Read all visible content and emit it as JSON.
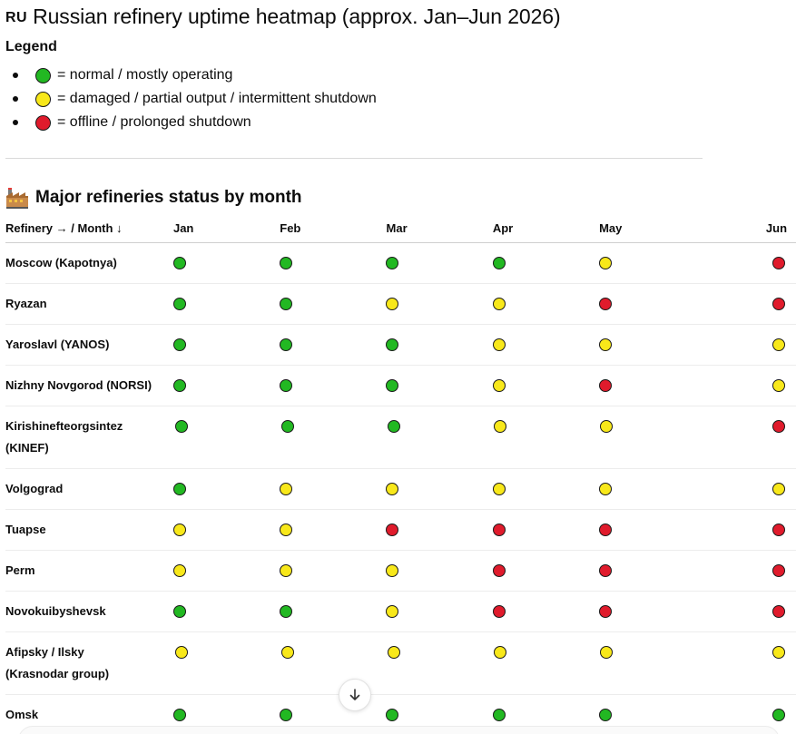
{
  "header": {
    "flag": "RU",
    "title": "Russian refinery uptime heatmap (approx. Jan–Jun 2026)"
  },
  "legend": {
    "heading": "Legend",
    "items": [
      {
        "status": "green",
        "label": "= normal / mostly operating"
      },
      {
        "status": "yellow",
        "label": "= damaged / partial output / intermittent shutdown"
      },
      {
        "status": "red",
        "label": "= offline / prolonged shutdown"
      }
    ]
  },
  "colors": {
    "green": "#22b822",
    "yellow": "#f8e81a",
    "red": "#e01b2c"
  },
  "section": {
    "icon": "factory-icon",
    "heading": "Major refineries status by month"
  },
  "table": {
    "corner_label": "Refinery → / Month ↓",
    "months": [
      "Jan",
      "Feb",
      "Mar",
      "Apr",
      "May",
      "Jun"
    ],
    "rows": [
      {
        "name": "Moscow (Kapotnya)",
        "statuses": [
          "green",
          "green",
          "green",
          "green",
          "yellow",
          "red"
        ]
      },
      {
        "name": "Ryazan",
        "statuses": [
          "green",
          "green",
          "yellow",
          "yellow",
          "red",
          "red"
        ]
      },
      {
        "name": "Yaroslavl (YANOS)",
        "statuses": [
          "green",
          "green",
          "green",
          "yellow",
          "yellow",
          "yellow"
        ]
      },
      {
        "name": "Nizhny Novgorod (NORSI)",
        "statuses": [
          "green",
          "green",
          "green",
          "yellow",
          "red",
          "yellow"
        ]
      },
      {
        "name": "Kirishinefteorgsintez (KINEF)",
        "statuses": [
          "green",
          "green",
          "green",
          "yellow",
          "yellow",
          "red"
        ]
      },
      {
        "name": "Volgograd",
        "statuses": [
          "green",
          "yellow",
          "yellow",
          "yellow",
          "yellow",
          "yellow"
        ]
      },
      {
        "name": "Tuapse",
        "statuses": [
          "yellow",
          "yellow",
          "red",
          "red",
          "red",
          "red"
        ]
      },
      {
        "name": "Perm",
        "statuses": [
          "yellow",
          "yellow",
          "yellow",
          "red",
          "red",
          "red"
        ]
      },
      {
        "name": "Novokuibyshevsk",
        "statuses": [
          "green",
          "green",
          "yellow",
          "red",
          "red",
          "red"
        ]
      },
      {
        "name": "Afipsky / Ilsky (Krasnodar group)",
        "statuses": [
          "yellow",
          "yellow",
          "yellow",
          "yellow",
          "yellow",
          "yellow"
        ]
      },
      {
        "name": "Omsk",
        "statuses": [
          "green",
          "green",
          "green",
          "green",
          "green",
          "green"
        ]
      }
    ]
  },
  "scroll_button": {
    "icon": "arrow-down-icon"
  }
}
